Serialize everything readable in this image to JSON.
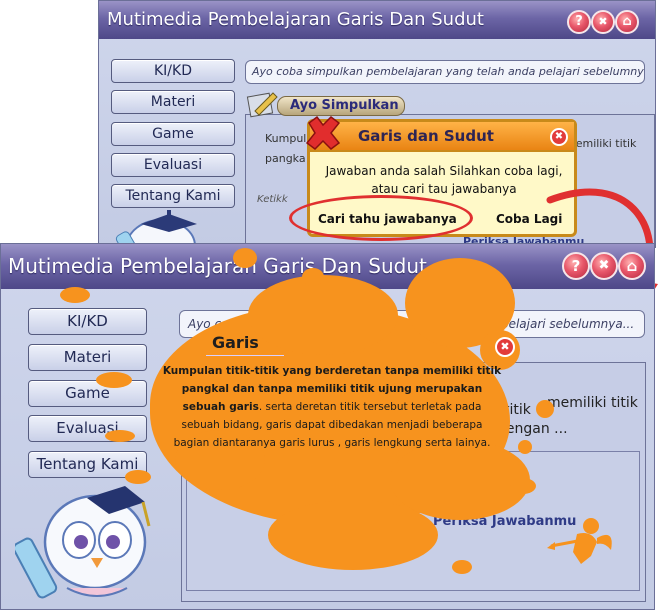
{
  "back_window": {
    "title": "Mutimedia Pembelajaran Garis Dan Sudut",
    "title_buttons": [
      "?",
      "✖",
      "⌂"
    ],
    "sidebar": [
      {
        "label": "KI/KD"
      },
      {
        "label": "Materi"
      },
      {
        "label": "Game"
      },
      {
        "label": "Evaluasi"
      },
      {
        "label": "Tentang Kami"
      }
    ],
    "info_bar": "Ayo coba simpulkan pembelajaran yang telah anda pelajari sebelumnya...",
    "section_tag": "Ayo Simpulkan",
    "content_text_left": "Kumpul",
    "content_text_left2": "pangka",
    "content_text_right": "memiliki titik",
    "content_hint": "Ketikk",
    "check_button": "Periksa Jawabanmu",
    "dialog": {
      "title": "Garis dan Sudut",
      "message": "Jawaban anda salah Silahkan coba lagi, atau cari tau jawabanya",
      "btn_find": "Cari tahu jawabanya",
      "btn_retry": "Coba Lagi"
    }
  },
  "front_window": {
    "title": "Mutimedia Pembelajaran Garis Dan Sudut",
    "title_buttons": [
      "?",
      "✖",
      "⌂"
    ],
    "sidebar": [
      {
        "label": "KI/KD"
      },
      {
        "label": "Materi"
      },
      {
        "label": "Game"
      },
      {
        "label": "Evaluasi"
      },
      {
        "label": "Tentang Kami"
      }
    ],
    "info_bar": "Ayo coba simpulkan pembelajaran yang telah anda pelajari sebelumnya...",
    "content_text_right": "a titik",
    "content_text_right2": "memiliki titik",
    "content_text_line2": "dengan ...",
    "check_button": "Periksa Jawabanmu",
    "popup": {
      "title": "Garis",
      "body_bold": "Kumpulan titik-titik yang berderetan tanpa memiliki titik pangkal dan tanpa memiliki titik ujung merupakan sebuah garis",
      "body_rest": ". serta deretan titik tersebut terletak pada sebuah bidang, garis dapat dibedakan menjadi beberapa bagian diantaranya garis lurus , garis lengkung serta lainya."
    }
  },
  "colors": {
    "titlebar": "#6c65a6",
    "window_bg": "#c3cbe4",
    "orange": "#f7931e",
    "red_highlight": "#e03030",
    "dialog_bg": "#fff9c8",
    "dialog_border": "#c88a1a"
  },
  "icons": [
    "help-icon",
    "close-icon",
    "home-icon",
    "error-x-icon",
    "owl-mascot",
    "pencil-icon",
    "cupid-silhouette",
    "arrow-icon"
  ]
}
